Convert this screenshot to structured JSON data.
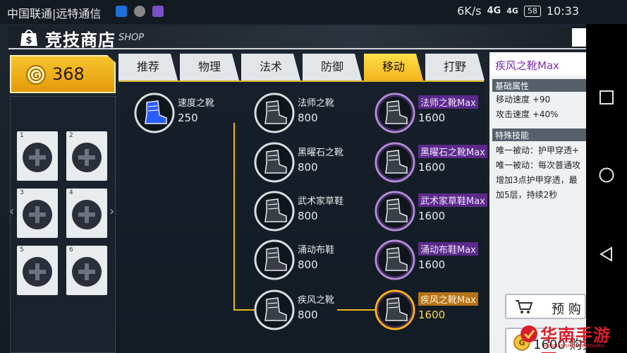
{
  "status_bar": {
    "carrier": "中国联通|远特通信",
    "speed": "6K/s",
    "net1": "4G",
    "net2": "4G",
    "battery": "58",
    "time": "10:33"
  },
  "header": {
    "title": "竞技商店",
    "subtitle": "SHOP"
  },
  "gold": {
    "amount": "368"
  },
  "slots": [
    "1",
    "2",
    "3",
    "4",
    "5",
    "6"
  ],
  "tabs": [
    {
      "label": "推荐",
      "active": false
    },
    {
      "label": "物理",
      "active": false
    },
    {
      "label": "法术",
      "active": false
    },
    {
      "label": "防御",
      "active": false
    },
    {
      "label": "移动",
      "active": true
    },
    {
      "label": "打野",
      "active": false
    }
  ],
  "items": {
    "base": {
      "name": "速度之靴",
      "price": "250"
    },
    "tier2": [
      {
        "name": "法师之靴",
        "price": "800"
      },
      {
        "name": "黑曜石之靴",
        "price": "800"
      },
      {
        "name": "武术家草鞋",
        "price": "800"
      },
      {
        "name": "涌动布鞋",
        "price": "800"
      },
      {
        "name": "疾风之靴",
        "price": "800"
      }
    ],
    "tier3": [
      {
        "name": "法师之靴Max",
        "price": "1600"
      },
      {
        "name": "黑曜石之靴Max",
        "price": "1600"
      },
      {
        "name": "武术家草鞋Max",
        "price": "1600"
      },
      {
        "name": "涌动布鞋Max",
        "price": "1600"
      },
      {
        "name": "疾风之靴Max",
        "price": "1600",
        "selected": true
      }
    ]
  },
  "detail": {
    "title": "疾风之靴Max",
    "base_attr_head": "基础属性",
    "attr1": "移动速度 +90",
    "attr2": "攻击速度 +40%",
    "skill_head": "特殊技能",
    "skill1": "唯一被动：护甲穿透+",
    "skill2": "唯一被动：每次普通攻",
    "skill3": "增加3点护甲穿透，最",
    "skill4": "加5层，持续2秒",
    "preorder_label": "预 购",
    "buy_label": "1600 购买"
  },
  "watermark": {
    "text": "华南手游网",
    "sub": "HUANANSHOUYOUWANG"
  },
  "colors": {
    "gold": "#f3b41c",
    "max_purple": "#5b2a8a",
    "accent_yellow": "#e7b820"
  }
}
